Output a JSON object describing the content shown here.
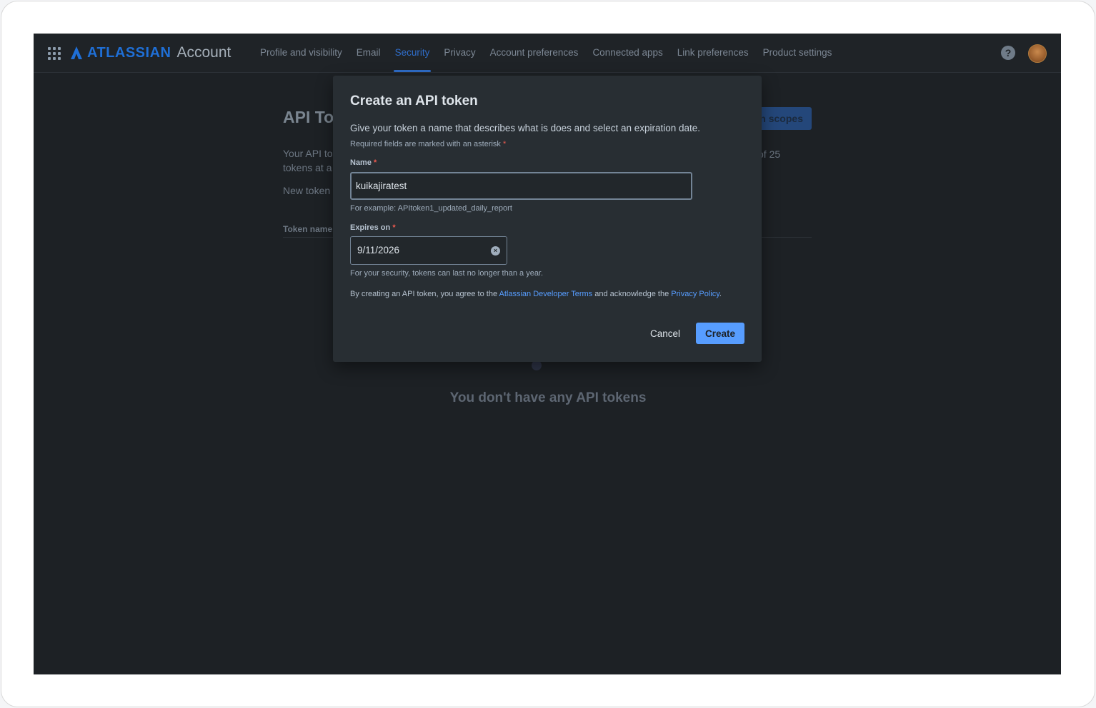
{
  "nav": {
    "brand": "ATLASSIAN",
    "product": "Account",
    "items": [
      {
        "label": "Profile and visibility"
      },
      {
        "label": "Email"
      },
      {
        "label": "Security"
      },
      {
        "label": "Privacy"
      },
      {
        "label": "Account preferences"
      },
      {
        "label": "Connected apps"
      },
      {
        "label": "Link preferences"
      },
      {
        "label": "Product settings"
      }
    ],
    "active_item": "Security",
    "help_glyph": "?"
  },
  "background": {
    "title": "API To",
    "desc": "Your API to tokens at a",
    "new_token": "New token",
    "table_header": "Token name",
    "scopes_button": "n scopes",
    "count_text": "of 25",
    "empty_message": "You don't have any API tokens"
  },
  "modal": {
    "title": "Create an API token",
    "description": "Give your token a name that describes what is does and select an expiration date.",
    "required_note": "Required fields are marked with an asterisk",
    "asterisk": "*",
    "name_label": "Name",
    "name_value": "kuikajiratest",
    "name_help": "For example: APItoken1_updated_daily_report",
    "expires_label": "Expires on",
    "expires_value": "9/11/2026",
    "expires_help": "For your security, tokens can last no longer than a year.",
    "terms_prefix": "By creating an API token, you agree to the ",
    "terms_link": "Atlassian Developer Terms",
    "terms_middle": " and acknowledge the ",
    "privacy_link": "Privacy Policy",
    "terms_suffix": ".",
    "cancel_label": "Cancel",
    "create_label": "Create"
  },
  "colors": {
    "accent": "#579dff",
    "nav_active": "#2f6dc9",
    "background": "#1d2125",
    "modal": "#282e33",
    "required": "#f15b50"
  },
  "icons": [
    "app-switcher-icon",
    "atlassian-logo-icon",
    "help-icon",
    "clear-icon"
  ]
}
